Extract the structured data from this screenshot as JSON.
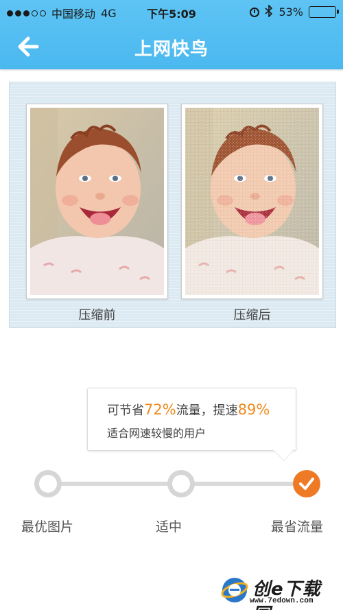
{
  "status_bar": {
    "carrier": "中国移动",
    "network": "4G",
    "time": "下午5:09",
    "battery_percent": "53%",
    "battery_level": 0.53,
    "signal_bars_filled": 3,
    "signal_bars_total": 5,
    "icons": [
      "alarm-icon",
      "bluetooth-icon",
      "battery-icon"
    ]
  },
  "nav": {
    "title": "上网快鸟",
    "back_icon": "arrow-left-icon"
  },
  "compare": {
    "before_label": "压缩前",
    "after_label": "压缩后"
  },
  "tooltip": {
    "line1_prefix": "可节省",
    "line1_traffic_value": "72%",
    "line1_middle": "流量，提速",
    "line1_speed_value": "89%",
    "line2": "适合网速较慢的用户"
  },
  "slider": {
    "options": [
      {
        "label": "最优图片",
        "selected": false
      },
      {
        "label": "适中",
        "selected": false
      },
      {
        "label": "最省流量",
        "selected": true
      }
    ]
  },
  "watermark": {
    "title": "创e下载园",
    "url": "www.7edown.com"
  },
  "colors": {
    "header": "#4ab8ef",
    "accent_orange": "#f08a1c",
    "selected_knob": "#ef7a26",
    "panel_bg": "#dbe9f2"
  }
}
